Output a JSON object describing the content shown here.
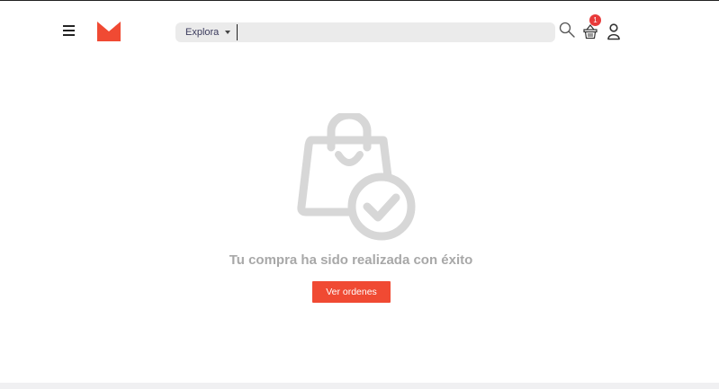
{
  "header": {
    "explore_label": "Explora",
    "search": {
      "value": "",
      "placeholder": ""
    },
    "cart_count": "1",
    "icons": {
      "menu": "hamburger-menu-icon",
      "logo": "m-brand-logo",
      "search": "magnifier-icon",
      "cart": "shopping-basket-icon",
      "user": "user-profile-icon"
    }
  },
  "main": {
    "icon": "shopping-bag-check-icon",
    "message": "Tu compra ha sido realizada con éxito",
    "orders_button_label": "Ver ordenes"
  },
  "colors": {
    "accent": "#f04a33",
    "badge": "#e83a3a",
    "message": "#a8a8a8",
    "search_bg": "#ebebeb",
    "icon_gray": "#d7d7d7"
  }
}
